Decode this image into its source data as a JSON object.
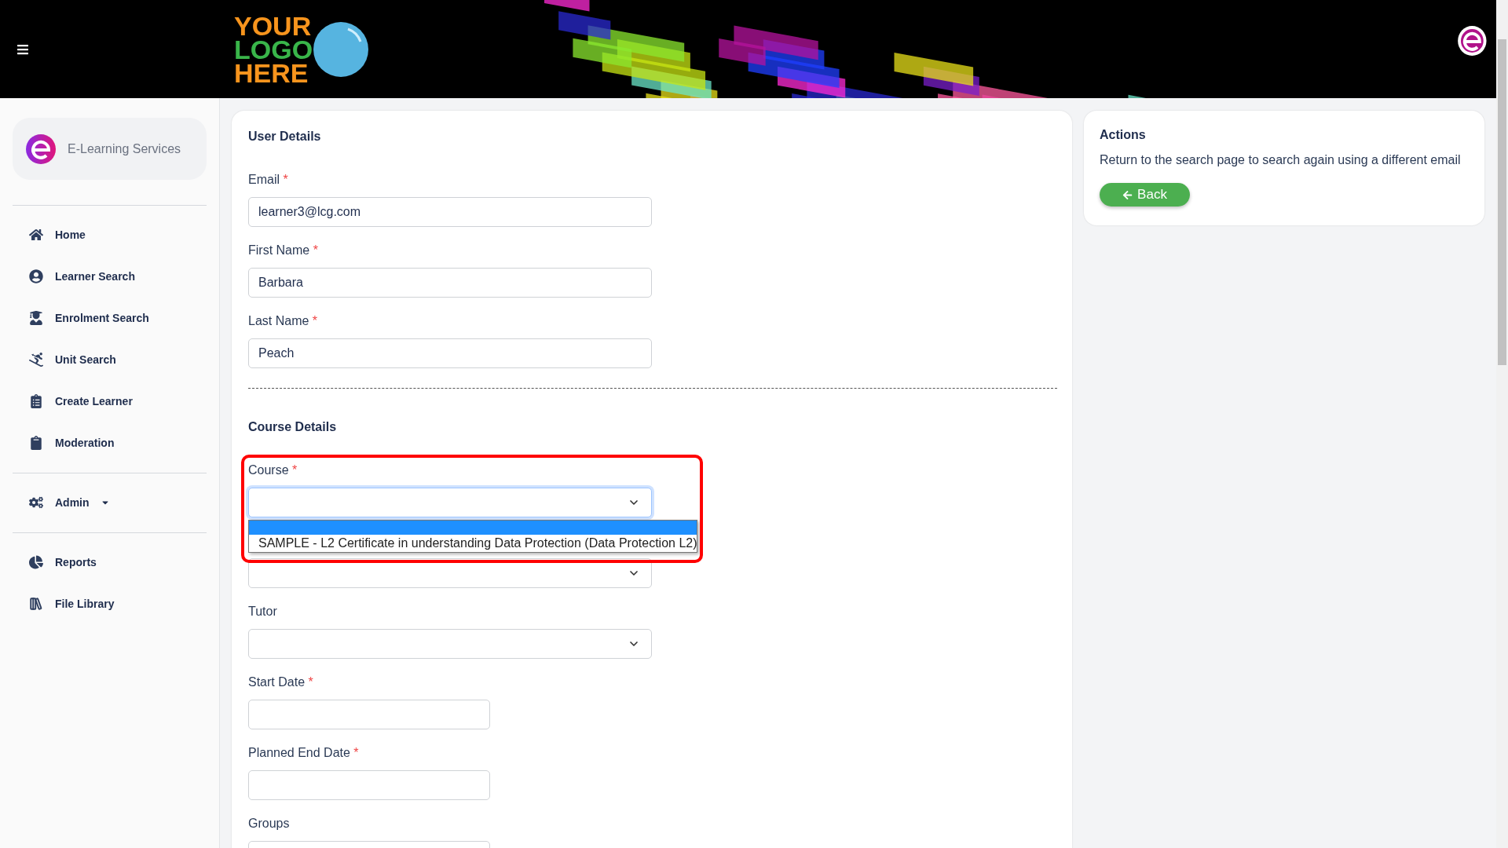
{
  "header": {
    "logo_lines": [
      "YOUR",
      "LOGO",
      "HERE"
    ]
  },
  "sidebar": {
    "brand": "E-Learning Services",
    "groups": [
      [
        {
          "label": "Home"
        },
        {
          "label": "Learner Search"
        },
        {
          "label": "Enrolment Search"
        },
        {
          "label": "Unit Search"
        },
        {
          "label": "Create Learner"
        },
        {
          "label": "Moderation"
        }
      ],
      [
        {
          "label": "Admin",
          "has_menu": true
        }
      ],
      [
        {
          "label": "Reports"
        },
        {
          "label": "File Library"
        }
      ]
    ]
  },
  "user_details": {
    "title": "User Details",
    "fields": [
      {
        "label": "Email",
        "marker": "*",
        "value": "learner3@lcg.com"
      },
      {
        "label": "First Name",
        "marker": "*",
        "value": "Barbara"
      },
      {
        "label": "Last Name",
        "marker": "*",
        "value": "Peach"
      }
    ]
  },
  "course_details": {
    "title": "Course Details",
    "fields": [
      {
        "kind": "select",
        "label": "Course",
        "marker": "*",
        "focused": true,
        "options": [
          {
            "selected": true
          },
          {
            "label": "SAMPLE - L2 Certificate in understanding Data Protection (Data Protection L2)",
            "selected": false
          }
        ]
      },
      {
        "kind": "select"
      },
      {
        "kind": "select",
        "label": "Tutor"
      },
      {
        "kind": "text",
        "label": "Start Date",
        "marker": "*"
      },
      {
        "kind": "text",
        "label": "Planned End Date",
        "marker": "*"
      },
      {
        "kind": "text",
        "label": "Groups"
      }
    ]
  },
  "actions": {
    "title": "Actions",
    "text": "Return to the search page to search again using a different email",
    "button": "Back"
  }
}
